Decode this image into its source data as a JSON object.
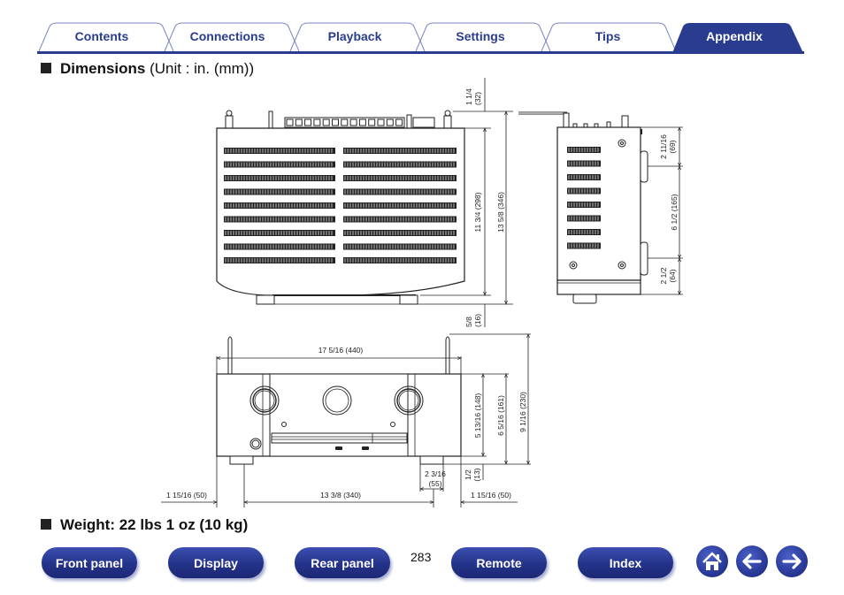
{
  "tabs": [
    {
      "label": "Contents",
      "active": false
    },
    {
      "label": "Connections",
      "active": false
    },
    {
      "label": "Playback",
      "active": false
    },
    {
      "label": "Settings",
      "active": false
    },
    {
      "label": "Tips",
      "active": false
    },
    {
      "label": "Appendix",
      "active": true
    }
  ],
  "colors": {
    "accent": "#2a3c8f",
    "active_tab": "#2a3c8f"
  },
  "dimensions_section": {
    "title_bold": "Dimensions",
    "title_unit": " (Unit : in. (mm))"
  },
  "top_view": {
    "rear_protrusion": [
      "1 1/4",
      "(32)"
    ],
    "body_depth": "11 3/4 (298)",
    "total_depth": "13 5/8 (346)",
    "front_protrusion": [
      "5/8",
      "(16)"
    ]
  },
  "side_view": {
    "upper": [
      "2 11/16",
      "(69)"
    ],
    "middle": "6 1/2 (165)",
    "lower": [
      "2 1/2",
      "(64)"
    ]
  },
  "front_view": {
    "width": "17 5/16 (440)",
    "body_height": "5 13/16 (148)",
    "height_with_feet": "6 5/16 (161)",
    "height_with_antenna": "9 1/16 (230)",
    "foot_width": [
      "2 3/16",
      "(55)"
    ],
    "foot_height": [
      "1/2",
      "(13)"
    ],
    "left_offset": "1 15/16 (50)",
    "foot_spacing": "13 3/8 (340)",
    "right_offset": "1 15/16 (50)"
  },
  "weight_section": {
    "title": "Weight: 22 lbs 1 oz (10 kg)"
  },
  "footer": {
    "buttons": [
      {
        "label": "Front panel"
      },
      {
        "label": "Display"
      },
      {
        "label": "Rear panel"
      },
      {
        "label": "Remote"
      },
      {
        "label": "Index"
      }
    ],
    "page_number": "283",
    "icons": [
      "home-icon",
      "back-arrow-icon",
      "forward-arrow-icon"
    ]
  }
}
